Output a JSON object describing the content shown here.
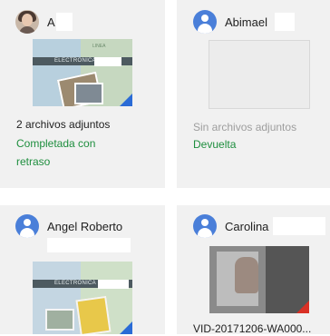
{
  "students": [
    {
      "name": "A",
      "avatar": "person-photo",
      "thumbnail_type": "document-image",
      "thumbnail_band_text": "ELECTRONICA",
      "thumbnail_tag_text": "LINEA",
      "attachments": "2 archivos adjuntos",
      "status": "Completada con retraso",
      "status_color": "#1e8e3e"
    },
    {
      "name": "Abimael",
      "avatar": "default-avatar",
      "thumbnail_type": "empty",
      "attachments": "Sin archivos adjuntos",
      "status": "Devuelta",
      "status_color": "#1e8e3e"
    },
    {
      "name": "Angel Roberto",
      "avatar": "default-avatar",
      "thumbnail_type": "document-image",
      "thumbnail_band_text": "ELECTRONICA",
      "attachments": "",
      "status": ""
    },
    {
      "name": "Carolina",
      "avatar": "default-avatar",
      "thumbnail_type": "video",
      "attachments": "VID-20171206-WA000...",
      "status": ""
    }
  ],
  "colors": {
    "card_bg": "#f1f1f1",
    "accent_green": "#1e8e3e",
    "avatar_blue": "#4a7fd9",
    "drive_corner_blue": "#2a6bd6",
    "video_corner_red": "#d93025"
  }
}
